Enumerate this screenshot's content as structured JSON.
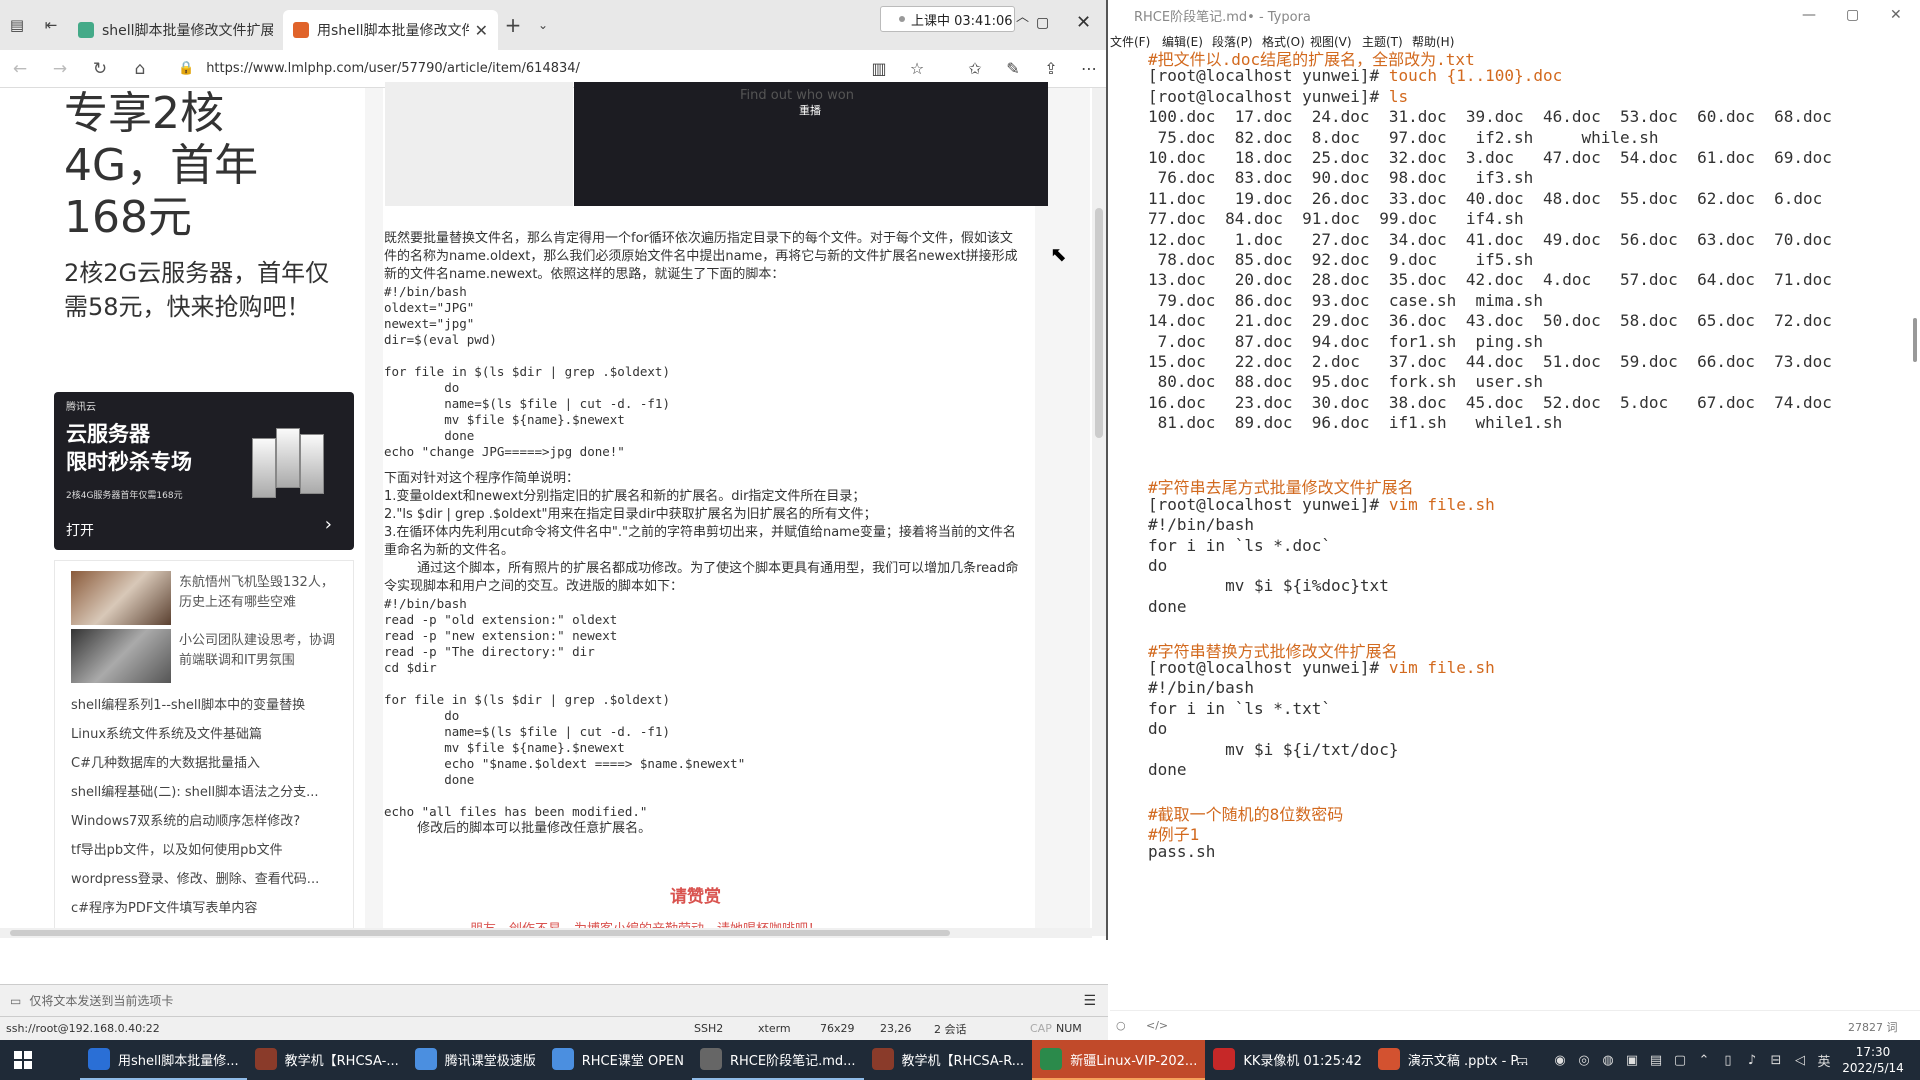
{
  "browser": {
    "tabs": [
      {
        "label": "shell脚本批量修改文件扩展",
        "active": false
      },
      {
        "label": "用shell脚本批量修改文件",
        "active": true
      }
    ],
    "class_status": "上课中 03:41:06",
    "url": "https://www.lmlphp.com/user/57790/article/item/614834/",
    "sidebar": {
      "promo_big": "专享2核\n4G，首年\n168元",
      "promo_small": "2核2G云服务器，首年仅需58元，快来抢购吧！",
      "ad": {
        "brand": "腾讯云",
        "headline": "云服务器\n限时秒杀专场",
        "sub": "2核4G服务器首年仅需168元",
        "open": "打开"
      },
      "news_image_items": [
        "东航悟州飞机坠毁132人，历史上还有哪些空难",
        "小公司团队建设思考，协调前端联调和IT男氛围"
      ],
      "news_links": [
        "shell编程系列1--shell脚本中的变量替换",
        "Linux系统文件系统及文件基础篇",
        "C#几种数据库的大数据批量插入",
        "shell编程基础(二): shell脚本语法之分支...",
        "Windows7双系统的启动顺序怎样修改?",
        "tf导出pb文件，以及如何使用pb文件",
        "wordpress登录、修改、删除、查看代码...",
        "c#程序为PDF文件填写表单内容"
      ]
    },
    "video": {
      "text": "Find out who won",
      "play": "重播"
    },
    "article": {
      "para1": "既然要批量替换文件名，那么肯定得用一个for循环依次遍历指定目录下的每个文件。对于每个文件，假如该文件的名称为name.oldext，那么我们必须原始文件名中提出name，再将它与新的文件扩展名newext拼接形成新的文件名name.newext。依照这样的思路，就诞生了下面的脚本：",
      "code1": "#!/bin/bash\noldext=\"JPG\"\nnewext=\"jpg\"\ndir=$(eval pwd)\n\nfor file in $(ls $dir | grep .$oldext)\n        do\n        name=$(ls $file | cut -d. -f1)\n        mv $file ${name}.$newext\n        done\necho \"change JPG=====>jpg done!\"",
      "para2": "下面对针对这个程序作简单说明：",
      "item1": "1.变量oldext和newext分别指定旧的扩展名和新的扩展名。dir指定文件所在目录；",
      "item2": "2.\"ls $dir | grep .$oldext\"用来在指定目录dir中获取扩展名为旧扩展名的所有文件；",
      "item3": "3.在循环体内先利用cut命令将文件名中\".\"之前的字符串剪切出来，并赋值给name变量；接着将当前的文件名重命名为新的文件名。",
      "para3": "        通过这个脚本，所有照片的扩展名都成功修改。为了使这个脚本更具有通用型，我们可以增加几条read命令实现脚本和用户之间的交互。改进版的脚本如下：",
      "code2": "#!/bin/bash\nread -p \"old extension:\" oldext\nread -p \"new extension:\" newext\nread -p \"The directory:\" dir\ncd $dir\n\nfor file in $(ls $dir | grep .$oldext)\n        do\n        name=$(ls $file | cut -d. -f1)\n        mv $file ${name}.$newext\n        echo \"$name.$oldext ====> $name.$newext\"\n        done\n\necho \"all files has been modified.\"",
      "para4": "        修改后的脚本可以批量修改任意扩展名。",
      "praise": "请赞赏",
      "praise_sub": "朋友，创作不易，为博客小编的辛勤劳动，请她喝杯咖啡吧！"
    }
  },
  "terminal": {
    "send_placeholder": "仅将文本发送到当前选项卡",
    "status": {
      "host": "ssh://root@192.168.0.40:22",
      "proto": "SSH2",
      "term": "xterm",
      "size": "76x29",
      "pos": "23,26",
      "sessions": "2 会话",
      "cap": "CAP",
      "num": "NUM"
    }
  },
  "typora": {
    "title": "RHCE阶段笔记.md• - Typora",
    "menu": [
      "文件(F)",
      "编辑(E)",
      "段落(P)",
      "格式(O)",
      "视图(V)",
      "主题(T)",
      "帮助(H)"
    ],
    "lines": [
      {
        "t": "#把文件以.doc结尾的扩展名，全部改为.txt",
        "k": "cm"
      },
      {
        "p": "[root@localhost yunwei]# ",
        "c": "touch {1..100}.doc"
      },
      {
        "p": "[root@localhost yunwei]# ",
        "c": "ls"
      },
      {
        "t": "100.doc  17.doc  24.doc  31.doc  39.doc  46.doc  53.doc  60.doc  68.doc"
      },
      {
        "t": " 75.doc  82.doc  8.doc   97.doc   if2.sh     while.sh"
      },
      {
        "t": "10.doc   18.doc  25.doc  32.doc  3.doc   47.doc  54.doc  61.doc  69.doc"
      },
      {
        "t": " 76.doc  83.doc  90.doc  98.doc   if3.sh"
      },
      {
        "t": "11.doc   19.doc  26.doc  33.doc  40.doc  48.doc  55.doc  62.doc  6.doc"
      },
      {
        "t": "77.doc  84.doc  91.doc  99.doc   if4.sh"
      },
      {
        "t": "12.doc   1.doc   27.doc  34.doc  41.doc  49.doc  56.doc  63.doc  70.doc"
      },
      {
        "t": " 78.doc  85.doc  92.doc  9.doc    if5.sh"
      },
      {
        "t": "13.doc   20.doc  28.doc  35.doc  42.doc  4.doc   57.doc  64.doc  71.doc"
      },
      {
        "t": " 79.doc  86.doc  93.doc  case.sh  mima.sh"
      },
      {
        "t": "14.doc   21.doc  29.doc  36.doc  43.doc  50.doc  58.doc  65.doc  72.doc"
      },
      {
        "t": " 7.doc   87.doc  94.doc  for1.sh  ping.sh"
      },
      {
        "t": "15.doc   22.doc  2.doc   37.doc  44.doc  51.doc  59.doc  66.doc  73.doc"
      },
      {
        "t": " 80.doc  88.doc  95.doc  fork.sh  user.sh"
      },
      {
        "t": "16.doc   23.doc  30.doc  38.doc  45.doc  52.doc  5.doc   67.doc  74.doc"
      },
      {
        "t": " 81.doc  89.doc  96.doc  if1.sh   while1.sh"
      },
      {
        "t": ""
      },
      {
        "t": ""
      },
      {
        "t": "#字符串去尾方式批量修改文件扩展名",
        "k": "cm"
      },
      {
        "p": "[root@localhost yunwei]# ",
        "c": "vim file.sh"
      },
      {
        "t": "#!/bin/bash"
      },
      {
        "t": "for i in `ls *.doc`"
      },
      {
        "t": "do"
      },
      {
        "t": "        mv $i ${i%doc}txt"
      },
      {
        "t": "done"
      },
      {
        "t": ""
      },
      {
        "t": "#字符串替换方式批修改文件扩展名",
        "k": "cm"
      },
      {
        "p": "[root@localhost yunwei]# ",
        "c": "vim file.sh"
      },
      {
        "t": "#!/bin/bash"
      },
      {
        "t": "for i in `ls *.txt`"
      },
      {
        "t": "do"
      },
      {
        "t": "        mv $i ${i/txt/doc}"
      },
      {
        "t": "done"
      },
      {
        "t": ""
      },
      {
        "t": "#截取一个随机的8位数密码",
        "k": "cm"
      },
      {
        "t": "#例子1",
        "k": "cm"
      },
      {
        "t": "pass.sh"
      }
    ],
    "word_count": "27827 词"
  },
  "taskbar": {
    "items": [
      {
        "label": "用shell脚本批量修...",
        "color": "#2a6fd6",
        "state": "sel"
      },
      {
        "label": "教学机【RHCSA-...",
        "color": "#8a3b2a",
        "state": ""
      },
      {
        "label": "腾讯课堂极速版",
        "color": "#4b8fe0",
        "state": ""
      },
      {
        "label": "RHCE课堂 OPEN",
        "color": "#4b8fe0",
        "state": ""
      },
      {
        "label": "RHCE阶段笔记.md...",
        "color": "#666666",
        "state": "sel"
      },
      {
        "label": "教学机【RHCSA-R...",
        "color": "#8a3b2a",
        "state": ""
      },
      {
        "label": "新疆Linux-VIP-202...",
        "color": "#2b8a4b",
        "state": "active"
      },
      {
        "label": "KK录像机 01:25:42",
        "color": "#c62828",
        "state": ""
      },
      {
        "label": "演示文稿 .pptx - P...",
        "color": "#d35230",
        "state": ""
      }
    ],
    "tray_lang": "英",
    "time": "17:30",
    "date": "2022/5/14"
  }
}
